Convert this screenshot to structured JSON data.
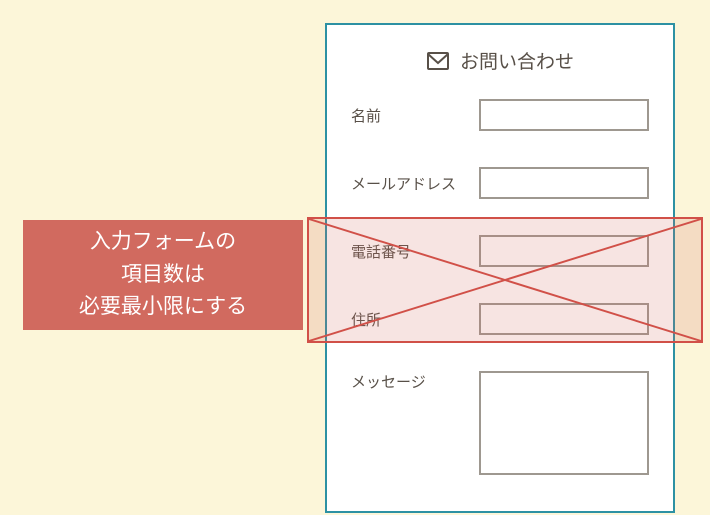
{
  "callout": {
    "line1": "入力フォームの",
    "line2": "項目数は",
    "line3": "必要最小限にする"
  },
  "form": {
    "title": "お問い合わせ",
    "fields": {
      "name": "名前",
      "email": "メールアドレス",
      "phone": "電話番号",
      "address": "住所",
      "message": "メッセージ"
    }
  },
  "colors": {
    "background": "#fcf6d9",
    "callout_bg": "#d16a5f",
    "panel_border": "#2d91a3",
    "cross": "#d15048",
    "text": "#585048",
    "input_border": "#9e9890"
  }
}
